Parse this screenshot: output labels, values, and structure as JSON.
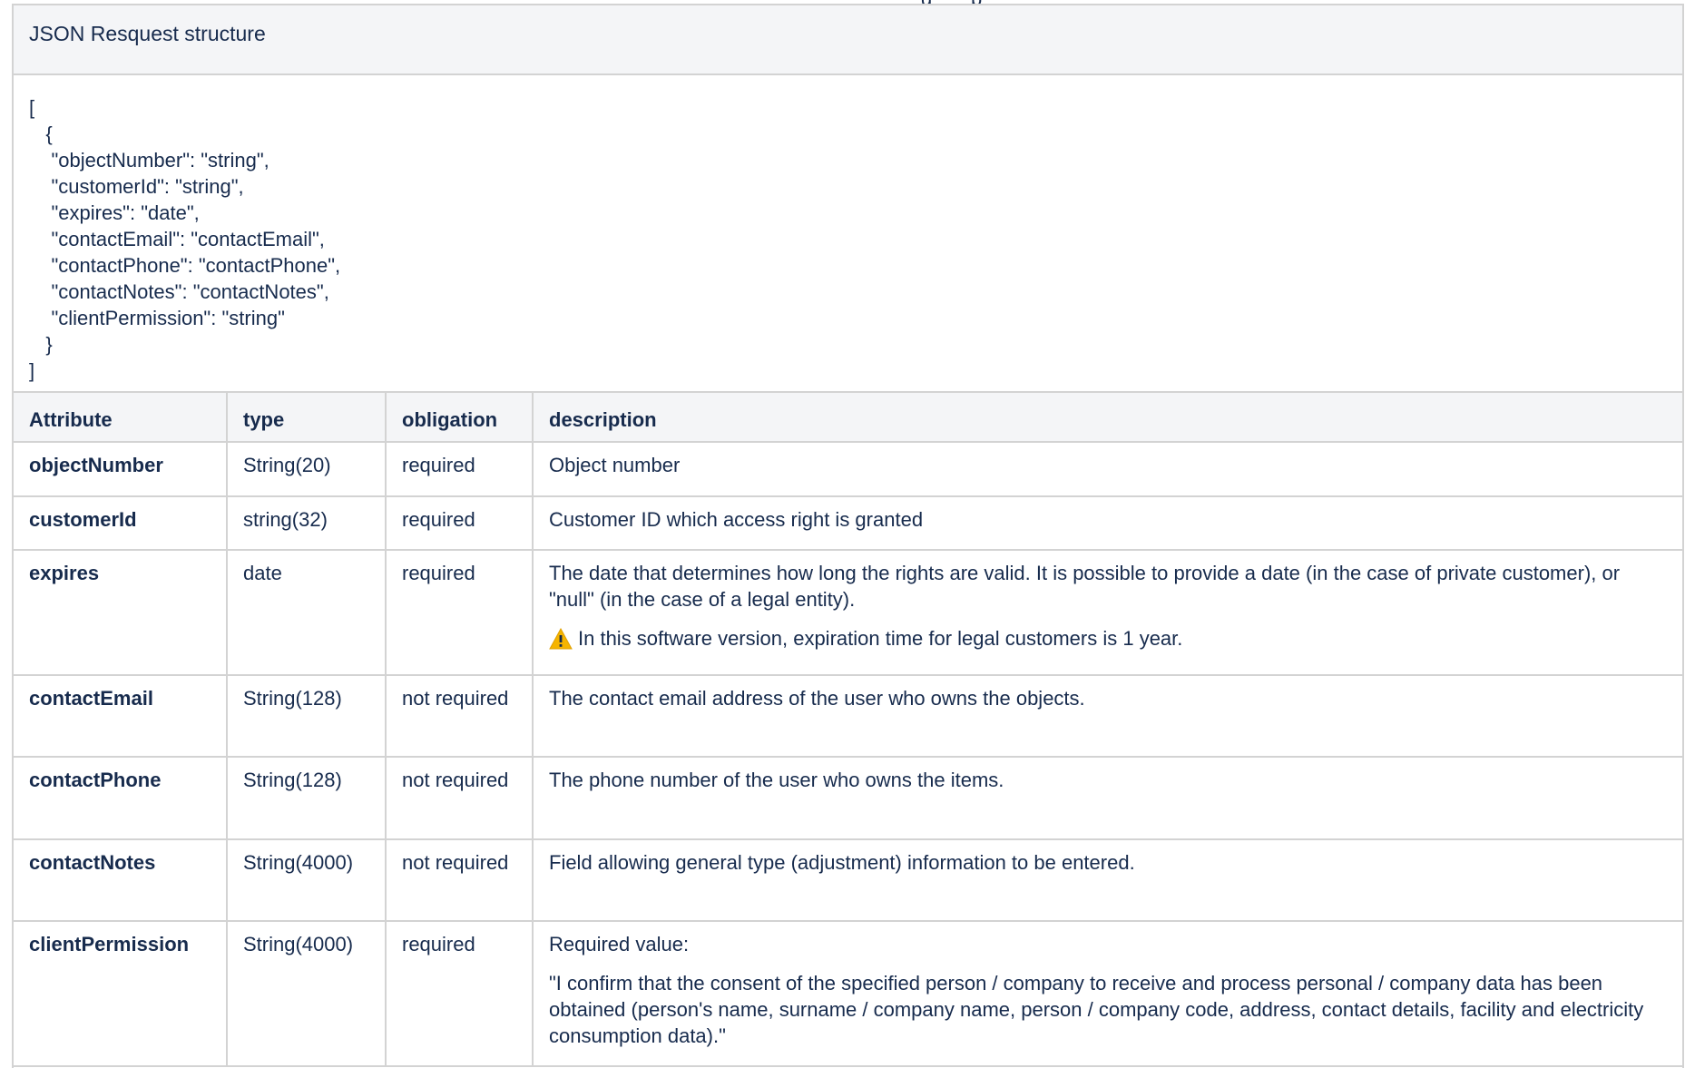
{
  "page_top_fragment": "g       p",
  "section": {
    "title": "JSON Resquest structure"
  },
  "json_example": {
    "lines": [
      "[",
      "   {",
      "    \"objectNumber\": \"string\",",
      "    \"customerId\": \"string\",",
      "    \"expires\": \"date\",",
      "    \"contactEmail\": \"contactEmail\",",
      "    \"contactPhone\": \"contactPhone\",",
      "    \"contactNotes\": \"contactNotes\",",
      "    \"clientPermission\": \"string\"",
      "   }",
      "]"
    ]
  },
  "table": {
    "headers": {
      "attribute": "Attribute",
      "type": "type",
      "obligation": "obligation",
      "description": "description"
    },
    "rows": [
      {
        "attribute": "objectNumber",
        "type": "String(20)",
        "obligation": "required",
        "description": "Object number"
      },
      {
        "attribute": "customerId",
        "type": "string(32)",
        "obligation": "required",
        "description": "Customer ID which access right is granted"
      },
      {
        "attribute": "expires",
        "type": "date",
        "obligation": "required",
        "description": "The date that determines how long the rights are valid. It is possible to provide a date (in the case of private customer), or \"null\" (in the case of a legal entity).",
        "warning": "In this software version, expiration time for legal customers is 1 year."
      },
      {
        "attribute": "contactEmail",
        "type": "String(128)",
        "obligation": "not required",
        "description": "The contact email address of the user who owns the objects."
      },
      {
        "attribute": "contactPhone",
        "type": "String(128)",
        "obligation": "not required",
        "description": "The phone number of the user who owns the items."
      },
      {
        "attribute": "contactNotes",
        "type": "String(4000)",
        "obligation": "not required",
        "description": "Field allowing general type (adjustment) information to be entered."
      },
      {
        "attribute": "clientPermission",
        "type": "String(4000)",
        "obligation": "required",
        "description": "Required value:",
        "description_extra": "\"I confirm that the consent of the specified person / company to receive and process personal / company data has been obtained (person's name, surname / company name, person / company code, address, contact details, facility and electricity consumption data).\""
      }
    ]
  },
  "colors": {
    "text": "#172b4d",
    "header_bg": "#f4f5f7",
    "border": "#d3d3d3",
    "warning": "#f5b400"
  },
  "icons": {
    "warning": "warning-triangle-icon"
  }
}
